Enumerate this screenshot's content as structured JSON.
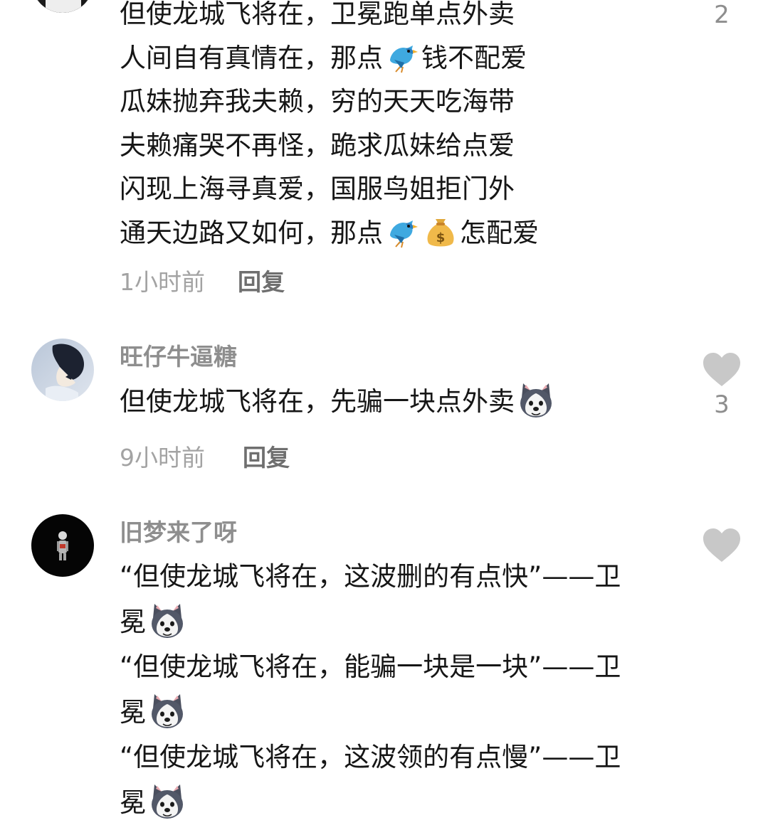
{
  "colors": {
    "text": "#161616",
    "username": "#8e8e8e",
    "meta": "#a3a3a3",
    "reply": "#6f6f6f",
    "heart": "#c8c8c8"
  },
  "comments": [
    {
      "likes": "2",
      "lines": [
        [
          "但使龙城飞将在，卫冕跑单点外卖"
        ],
        [
          "人间自有真情在，那点",
          "bird-emoji",
          "钱不配爱"
        ],
        [
          "瓜妹抛弃我夫赖，穷的天天吃海带"
        ],
        [
          "夫赖痛哭不再怪，跪求瓜妹给点爱"
        ],
        [
          "闪现上海寻真爱，国服鸟姐拒门外"
        ],
        [
          "通天边路又如何，那点",
          "bird-emoji",
          "moneybag-emoji",
          "怎配爱"
        ]
      ],
      "time": "1小时前",
      "reply_label": "回复"
    },
    {
      "username": "旺仔牛逼糖",
      "avatar_icon": "anime-avatar",
      "likes": "3",
      "lines": [
        [
          "但使龙城飞将在，先骗一块点外卖",
          "husky-emoji"
        ]
      ],
      "time": "9小时前",
      "reply_label": "回复"
    },
    {
      "username": "旧梦来了呀",
      "avatar_icon": "dark-figure-avatar",
      "likes": "",
      "lines": [
        [
          "“但使龙城飞将在，这波删的有点快”——卫"
        ],
        [
          "冕",
          "husky-emoji"
        ],
        [
          "“但使龙城飞将在，能骗一块是一块”——卫"
        ],
        [
          "冕",
          "husky-emoji"
        ],
        [
          "“但使龙城飞将在，这波领的有点慢”——卫"
        ],
        [
          "冕",
          "husky-emoji"
        ]
      ]
    }
  ]
}
